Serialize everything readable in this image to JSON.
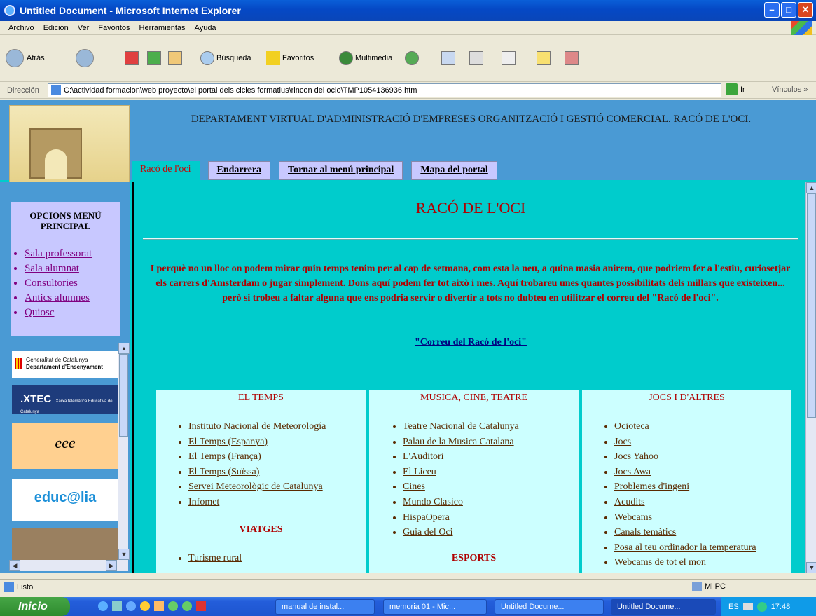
{
  "window": {
    "title": "Untitled Document - Microsoft Internet Explorer",
    "min": "–",
    "max": "□",
    "close": "✕"
  },
  "menu": [
    "Archivo",
    "Edición",
    "Ver",
    "Favoritos",
    "Herramientas",
    "Ayuda"
  ],
  "toolbar": {
    "back": "Atrás",
    "search": "Búsqueda",
    "favorites": "Favoritos",
    "multimedia": "Multimedia"
  },
  "address": {
    "label": "Dirección",
    "value": "C:\\actividad formacion\\web proyecto\\el portal dels cicles formatius\\rincon del ocio\\TMP1054136936.htm",
    "go": "Ir",
    "links": "Vínculos",
    "more": "»"
  },
  "header": {
    "title": "DEPARTAMENT VIRTUAL D'ADMINISTRACIÓ D'EMPRESES ORGANITZACIÓ I GESTIÓ COMERCIAL. RACÓ DE L'OCI.",
    "tabs": [
      "Racó de l'oci",
      "Endarrera",
      "Tornar al menú principal",
      "Mapa del portal"
    ]
  },
  "sidebar": {
    "title": "OPCIONS MENÚ PRINCIPAL",
    "items": [
      "Sala professorat",
      "Sala alumnat",
      "Consultories",
      "Antics alumnes",
      "Quiosc"
    ],
    "banners": {
      "gencat1": "Generalitat de Catalunya",
      "gencat2": "Departament d'Ensenyament",
      "xtec": ".XTEC",
      "xtec_sub": "Xarxa telemàtica Educativa de Catalunya",
      "eee": "eee",
      "educalia": "educ@lia"
    }
  },
  "main": {
    "title": "RACÓ DE L'OCI",
    "intro": "I perquè no un lloc on podem mirar quin temps tenim per al cap de setmana, com esta la neu, a quina masia anirem, que podriem fer a l'estiu, curiosetjar els carrers d'Amsterdam o jugar simplement. Dons aquí podem fer tot això i mes. Aquí trobareu unes quantes possibilitats dels millars que existeixen... però si trobeu a faltar alguna que ens podria servir o divertir a tots no dubteu en utilitzar el correu del \"Racó de l'oci\".",
    "mail_link": "\"Correu del Racó de l'oci\"",
    "col1": {
      "title": "EL TEMPS",
      "items": [
        "Instituto Nacional de Meteorología",
        "El Temps (Espanya)",
        "El Temps (França)",
        "El Temps (Suïssa)",
        "Servei Meteorològic de Catalunya",
        "Infomet"
      ],
      "sub": "VIATGES",
      "sub_items": [
        "Turisme rural"
      ]
    },
    "col2": {
      "title": "MUSICA, CINE, TEATRE",
      "items": [
        "Teatre Nacional de Catalunya",
        "Palau de la Musica Catalana",
        "L'Auditori",
        "El Liceu",
        "Cines",
        "Mundo Clasico",
        "HispaOpera",
        "Guia del Oci"
      ],
      "sub": "ESPORTS"
    },
    "col3": {
      "title": "JOCS I D'ALTRES",
      "items": [
        "Ocioteca",
        "Jocs",
        "Jocs Yahoo",
        "Jocs Awa",
        "Problemes d'ingeni",
        "Acudits",
        "Webcams",
        "Canals temàtics",
        "Posa al teu ordinador la temperatura",
        "Webcams de tot el mon"
      ]
    }
  },
  "status": {
    "text": "Listo",
    "zone": "Mi PC"
  },
  "taskbar": {
    "start": "Inicio",
    "tasks": [
      "manual de instal...",
      "memoria 01 - Mic...",
      "Untitled Docume...",
      "Untitled Docume..."
    ],
    "lang": "ES",
    "time": "17:48"
  }
}
